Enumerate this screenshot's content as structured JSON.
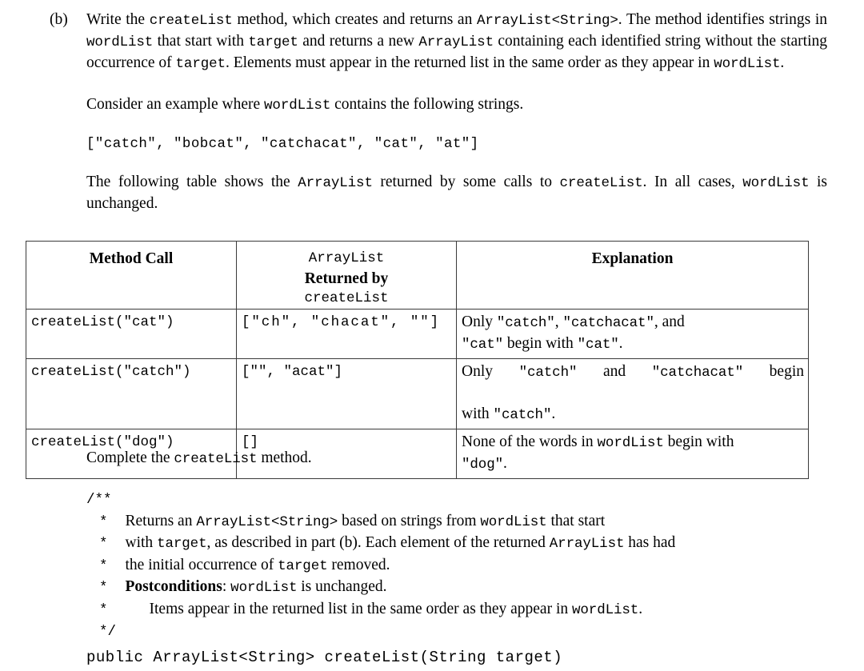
{
  "part": {
    "label": "(b)",
    "paragraph1": {
      "seg1": "Write the ",
      "code1": "createList",
      "seg2": " method, which creates and returns an ",
      "code2": "ArrayList<String>",
      "seg3": ". The method identifies strings in ",
      "code3": "wordList",
      "seg4": " that start with ",
      "code4": "target",
      "seg5": " and returns a new ",
      "code5": "ArrayList",
      "seg6": " containing each identified string without the starting occurrence of ",
      "code6": "target",
      "seg7": ". Elements must appear in the returned list in the same order as they appear in ",
      "code7": "wordList",
      "seg8": "."
    },
    "paragraph2": {
      "seg1": "Consider an example where ",
      "code1": "wordList",
      "seg2": " contains the following strings."
    },
    "example_list": "[\"catch\", \"bobcat\", \"catchacat\", \"cat\", \"at\"]",
    "paragraph3": {
      "seg1": "The following table shows the ",
      "code1": "ArrayList",
      "seg2": " returned by some calls to ",
      "code2": "createList",
      "seg3": ". In all cases, ",
      "code3": "wordList",
      "seg4": " is unchanged."
    }
  },
  "table": {
    "headers": {
      "method_call": "Method Call",
      "returned_by_line1": "ArrayList",
      "returned_by_line2": "Returned by",
      "returned_by_line3": "createList",
      "explanation": "Explanation"
    },
    "rows": [
      {
        "call": "createList(\"cat\")",
        "returned": "[\"ch\", \"chacat\", \"\"]",
        "explanation_line1_seg1": "Only ",
        "explanation_line1_code1": "\"catch\"",
        "explanation_line1_seg2": ", ",
        "explanation_line1_code2": "\"catchacat\"",
        "explanation_line1_seg3": ", and",
        "explanation_line2_code1": "\"cat\"",
        "explanation_line2_seg1": " begin with ",
        "explanation_line2_code2": "\"cat\"",
        "explanation_line2_seg2": "."
      },
      {
        "call": "createList(\"catch\")",
        "returned": "[\"\", \"acat\"]",
        "explanation_line1_seg1": "Only ",
        "explanation_line1_code1": "\"catch\"",
        "explanation_line1_seg2": " and ",
        "explanation_line1_code2": "\"catchacat\"",
        "explanation_line1_seg3": " begin",
        "explanation_line2_seg1": "with ",
        "explanation_line2_code1": "\"catch\"",
        "explanation_line2_seg2": "."
      },
      {
        "call": "createList(\"dog\")",
        "returned": "[]",
        "explanation_line1_seg1": "None of the words in ",
        "explanation_line1_code1": "wordList",
        "explanation_line1_seg2": " begin with",
        "explanation_line2_code1": "\"dog\"",
        "explanation_line2_seg1": "."
      }
    ]
  },
  "bottom": {
    "complete": {
      "seg1": "Complete the ",
      "code1": "createList",
      "seg2": " method."
    },
    "javadoc": {
      "open": "/**",
      "star": "*",
      "line1": {
        "seg1": "Returns an ",
        "code1": "ArrayList<String>",
        "seg2": " based on strings from ",
        "code2": "wordList",
        "seg3": " that start"
      },
      "line2": {
        "seg1": "with ",
        "code1": "target",
        "seg2": ", as described in part (b). Each element of the returned ",
        "code2": "ArrayList",
        "seg3": " has had"
      },
      "line3": {
        "seg1": "the initial occurrence of ",
        "code1": "target",
        "seg2": " removed."
      },
      "line4": {
        "bold1": "Postconditions",
        "seg1": ": ",
        "code1": "wordList",
        "seg2": " is unchanged."
      },
      "line5": {
        "seg1": "Items appear in the returned list in the same order as they appear in ",
        "code1": "wordList",
        "seg2": "."
      },
      "close": "*/"
    },
    "signature": "public ArrayList<String> createList(String target)"
  }
}
